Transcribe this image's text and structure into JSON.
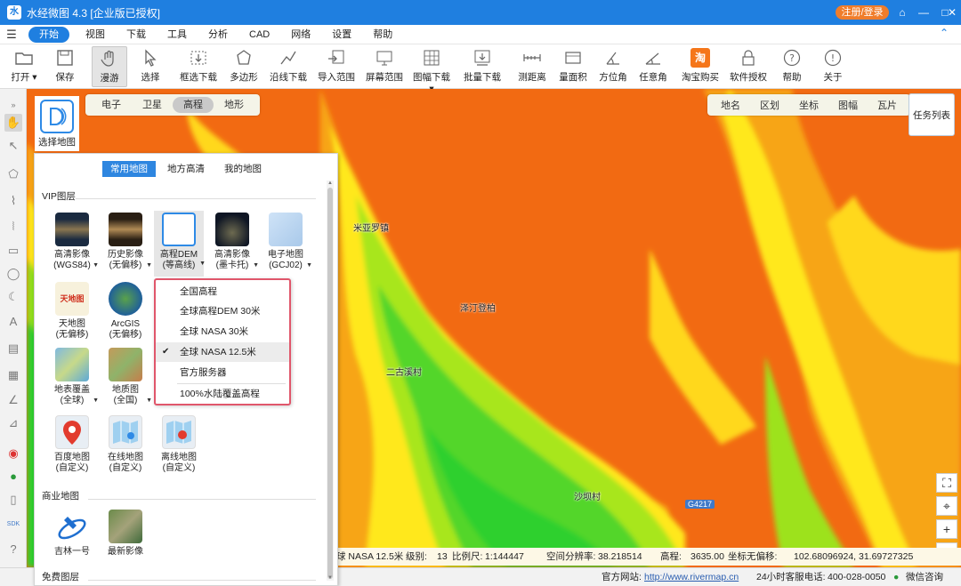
{
  "window": {
    "title": "水经微图 4.3 [企业版已授权]",
    "register_label": "注册/登录"
  },
  "menu": {
    "items": [
      "开始",
      "视图",
      "下载",
      "工具",
      "分析",
      "CAD",
      "网络",
      "设置",
      "帮助"
    ],
    "active": "开始"
  },
  "toolbar": {
    "items": [
      {
        "label": "打开",
        "icon": "folder-icon"
      },
      {
        "label": "保存",
        "icon": "save-icon"
      },
      {
        "label": "漫游",
        "icon": "hand-icon"
      },
      {
        "label": "选择",
        "icon": "cursor-icon"
      },
      {
        "label": "框选下载",
        "icon": "box-download-icon"
      },
      {
        "label": "多边形",
        "icon": "polygon-icon"
      },
      {
        "label": "沿线下载",
        "icon": "line-download-icon"
      },
      {
        "label": "导入范围",
        "icon": "import-range-icon"
      },
      {
        "label": "屏幕范围",
        "icon": "screen-range-icon"
      },
      {
        "label": "图幅下载",
        "icon": "sheet-download-icon"
      },
      {
        "label": "批量下载",
        "icon": "batch-download-icon"
      },
      {
        "label": "测距离",
        "icon": "measure-distance-icon"
      },
      {
        "label": "量面积",
        "icon": "measure-area-icon"
      },
      {
        "label": "方位角",
        "icon": "azimuth-icon"
      },
      {
        "label": "任意角",
        "icon": "angle-icon"
      },
      {
        "label": "淘宝购买",
        "icon": "taobao-icon"
      },
      {
        "label": "软件授权",
        "icon": "lock-icon"
      },
      {
        "label": "帮助",
        "icon": "help-icon"
      },
      {
        "label": "关于",
        "icon": "info-icon"
      }
    ]
  },
  "map_types": {
    "items": [
      "电子",
      "卫星",
      "高程",
      "地形"
    ],
    "active": "高程"
  },
  "overlay_toggles": [
    "地名",
    "区划",
    "坐标",
    "图幅",
    "瓦片"
  ],
  "task_list_label": "任务列表",
  "choose_map_label": "选择地图",
  "layer_panel": {
    "tabs": [
      "常用地图",
      "地方高清",
      "我的地图"
    ],
    "active_tab": "常用地图",
    "vip_section": "VIP图层",
    "commercial_section": "商业地图",
    "free_section": "免费图层",
    "vip_tiles": [
      {
        "l1": "高清影像",
        "l2": "(WGS84)"
      },
      {
        "l1": "历史影像",
        "l2": "(无偏移)"
      },
      {
        "l1": "高程DEM",
        "l2": "(等高线)"
      },
      {
        "l1": "高清影像",
        "l2": "(墨卡托)"
      },
      {
        "l1": "电子地图",
        "l2": "(GCJ02)"
      },
      {
        "l1": "天地图",
        "l2": "(无偏移)"
      },
      {
        "l1": "ArcGIS",
        "l2": "(无偏移)"
      },
      {
        "l1": "地表覆盖",
        "l2": "(全球)"
      },
      {
        "l1": "地质图",
        "l2": "(全国)"
      },
      {
        "l1": "百度地图",
        "l2": "(自定义)"
      },
      {
        "l1": "在线地图",
        "l2": "(自定义)"
      },
      {
        "l1": "离线地图",
        "l2": "(自定义)"
      }
    ],
    "commercial_tiles": [
      {
        "l1": "吉林一号"
      },
      {
        "l1": "最新影像"
      }
    ]
  },
  "dem_dropdown": {
    "items": [
      "全国高程",
      "全球高程DEM 30米",
      "全球 NASA 30米",
      "全球 NASA 12.5米",
      "官方服务器",
      "100%水陆覆盖高程"
    ],
    "checked": "全球 NASA 12.5米",
    "check_mark": "✔"
  },
  "map_labels": [
    "米亚罗镇",
    "泽汀登柏",
    "二古溪村",
    "沙坝村"
  ],
  "road_label": "G4217",
  "status": {
    "source": "球 NASA 12.5米",
    "level_label": "级别:",
    "level": "13",
    "scale_label": "比例尺:",
    "scale": "1:144447",
    "resolution_label": "空间分辨率:",
    "resolution": "38.218514",
    "elevation_label": "高程:",
    "elevation": "3635.00",
    "coord_label": "坐标无偏移:",
    "coords": "102.68096924, 31.69727325"
  },
  "footer": {
    "site_label": "官方网站:",
    "site_url": "http://www.rivermap.cn",
    "hotline_label": "24小时客服电话:",
    "hotline": "400-028-0050",
    "wechat": "微信咨询"
  },
  "zoom": {
    "plus": "+",
    "minus": "−"
  },
  "colors": {
    "titlebar": "#1f7fe0",
    "register": "#f07d2b",
    "dropdown_border": "#e0566b",
    "dem_high": "#f26a12",
    "dem_mid": "#ffe81c",
    "dem_low": "#2dd02d"
  }
}
